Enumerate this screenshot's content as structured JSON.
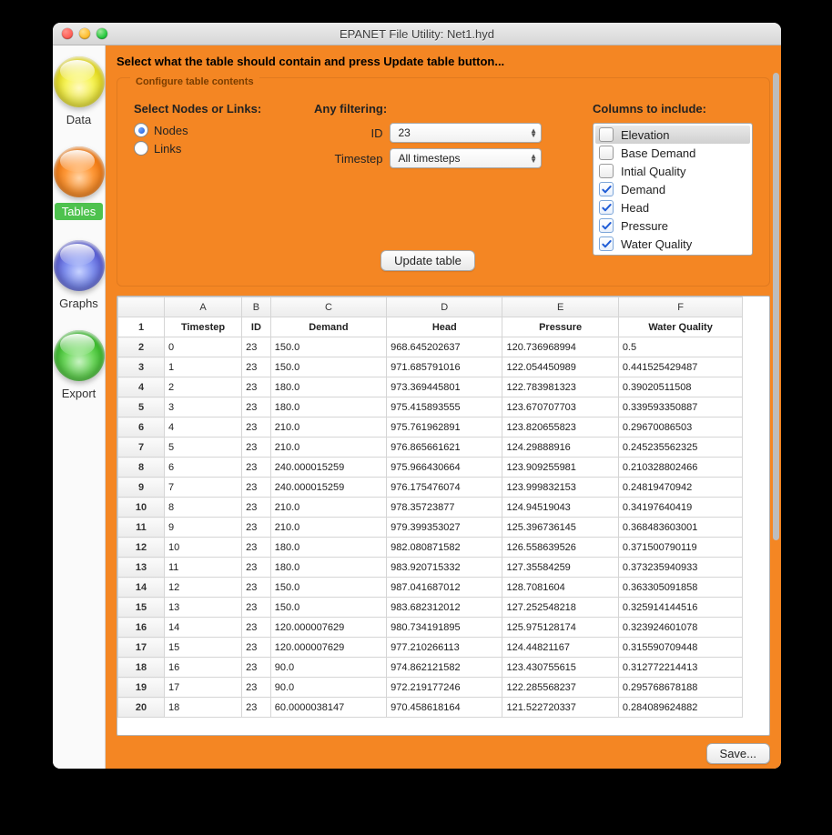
{
  "window": {
    "title": "EPANET File Utility: Net1.hyd"
  },
  "sidebar": {
    "items": [
      {
        "label": "Data",
        "active": false
      },
      {
        "label": "Tables",
        "active": true
      },
      {
        "label": "Graphs",
        "active": false
      },
      {
        "label": "Export",
        "active": false
      }
    ]
  },
  "main": {
    "instruction": "Select what the table should contain and press Update table button..."
  },
  "config": {
    "legend": "Configure table contents",
    "select_title": "Select Nodes or Links:",
    "radios": [
      {
        "label": "Nodes",
        "checked": true
      },
      {
        "label": "Links",
        "checked": false
      }
    ],
    "filter_title": "Any filtering:",
    "filters": {
      "id": {
        "label": "ID",
        "value": "23"
      },
      "timestep": {
        "label": "Timestep",
        "value": "All timesteps"
      }
    },
    "update_button": "Update table",
    "columns_title": "Columns to include:",
    "columns": [
      {
        "label": "Elevation",
        "checked": false,
        "selected": true
      },
      {
        "label": "Base Demand",
        "checked": false,
        "selected": false
      },
      {
        "label": "Intial Quality",
        "checked": false,
        "selected": false
      },
      {
        "label": "Demand",
        "checked": true,
        "selected": false
      },
      {
        "label": "Head",
        "checked": true,
        "selected": false
      },
      {
        "label": "Pressure",
        "checked": true,
        "selected": false
      },
      {
        "label": "Water Quality",
        "checked": true,
        "selected": false
      }
    ]
  },
  "table": {
    "column_letters": [
      "A",
      "B",
      "C",
      "D",
      "E",
      "F"
    ],
    "headers": [
      "Timestep",
      "ID",
      "Demand",
      "Head",
      "Pressure",
      "Water Quality"
    ],
    "rows": [
      [
        "0",
        "23",
        "150.0",
        "968.645202637",
        "120.736968994",
        "0.5"
      ],
      [
        "1",
        "23",
        "150.0",
        "971.685791016",
        "122.054450989",
        "0.441525429487"
      ],
      [
        "2",
        "23",
        "180.0",
        "973.369445801",
        "122.783981323",
        "0.39020511508"
      ],
      [
        "3",
        "23",
        "180.0",
        "975.415893555",
        "123.670707703",
        "0.339593350887"
      ],
      [
        "4",
        "23",
        "210.0",
        "975.761962891",
        "123.820655823",
        "0.29670086503"
      ],
      [
        "5",
        "23",
        "210.0",
        "976.865661621",
        "124.29888916",
        "0.245235562325"
      ],
      [
        "6",
        "23",
        "240.000015259",
        "975.966430664",
        "123.909255981",
        "0.210328802466"
      ],
      [
        "7",
        "23",
        "240.000015259",
        "976.175476074",
        "123.999832153",
        "0.24819470942"
      ],
      [
        "8",
        "23",
        "210.0",
        "978.35723877",
        "124.94519043",
        "0.34197640419"
      ],
      [
        "9",
        "23",
        "210.0",
        "979.399353027",
        "125.396736145",
        "0.368483603001"
      ],
      [
        "10",
        "23",
        "180.0",
        "982.080871582",
        "126.558639526",
        "0.371500790119"
      ],
      [
        "11",
        "23",
        "180.0",
        "983.920715332",
        "127.35584259",
        "0.373235940933"
      ],
      [
        "12",
        "23",
        "150.0",
        "987.041687012",
        "128.7081604",
        "0.363305091858"
      ],
      [
        "13",
        "23",
        "150.0",
        "983.682312012",
        "127.252548218",
        "0.325914144516"
      ],
      [
        "14",
        "23",
        "120.000007629",
        "980.734191895",
        "125.975128174",
        "0.323924601078"
      ],
      [
        "15",
        "23",
        "120.000007629",
        "977.210266113",
        "124.44821167",
        "0.315590709448"
      ],
      [
        "16",
        "23",
        "90.0",
        "974.862121582",
        "123.430755615",
        "0.312772214413"
      ],
      [
        "17",
        "23",
        "90.0",
        "972.219177246",
        "122.285568237",
        "0.295768678188"
      ],
      [
        "18",
        "23",
        "60.0000038147",
        "970.458618164",
        "121.522720337",
        "0.284089624882"
      ]
    ]
  },
  "footer": {
    "save_button": "Save..."
  }
}
